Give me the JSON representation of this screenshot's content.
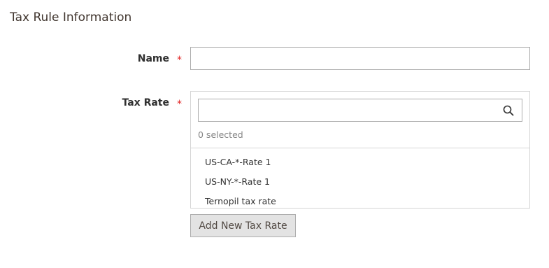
{
  "section": {
    "title": "Tax Rule Information"
  },
  "form": {
    "name": {
      "label": "Name",
      "required_mark": "*",
      "value": ""
    },
    "tax_rate": {
      "label": "Tax Rate",
      "required_mark": "*",
      "search_value": "",
      "selected_text": "0 selected",
      "options": [
        "US-CA-*-Rate 1",
        "US-NY-*-Rate 1",
        "Ternopil tax rate"
      ],
      "add_button_label": "Add New Tax Rate"
    }
  },
  "icons": {
    "search": "search-icon"
  },
  "colors": {
    "required": "#e22626",
    "button_bg": "#e3e3e3",
    "title": "#41362f"
  }
}
